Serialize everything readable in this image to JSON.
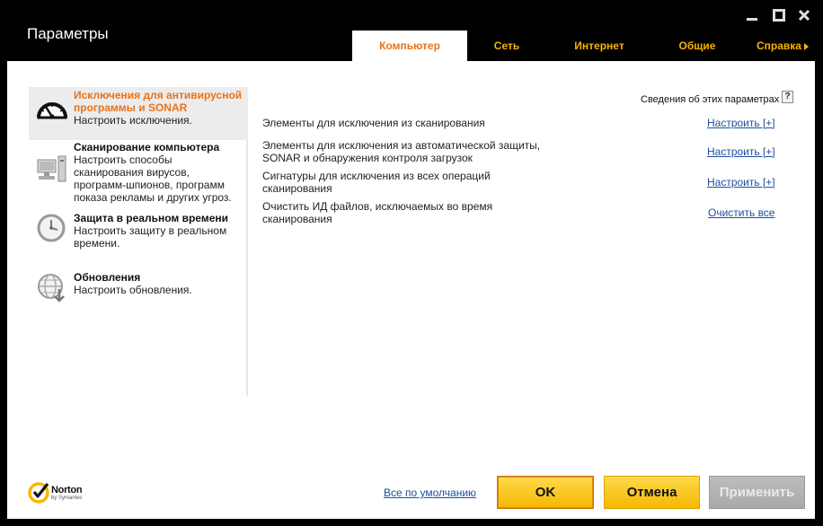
{
  "window": {
    "title": "Параметры"
  },
  "tabs": [
    {
      "label": "Компьютер",
      "active": true
    },
    {
      "label": "Сеть",
      "active": false
    },
    {
      "label": "Интернет",
      "active": false
    },
    {
      "label": "Общие",
      "active": false
    },
    {
      "label": "Справка",
      "active": false
    }
  ],
  "sidebar": {
    "items": [
      {
        "title": "Исключения для антивирусной программы и SONAR",
        "desc": "Настроить исключения.",
        "icon": "gauge-icon",
        "selected": true
      },
      {
        "title": "Сканирование компьютера",
        "desc": "Настроить способы сканирования вирусов, программ-шпионов, программ показа рекламы и других угроз.",
        "icon": "computer-icon",
        "selected": false
      },
      {
        "title": "Защита в реальном времени",
        "desc": "Настроить защиту в реальном времени.",
        "icon": "clock-icon",
        "selected": false
      },
      {
        "title": "Обновления",
        "desc": "Настроить обновления.",
        "icon": "globe-update-icon",
        "selected": false
      }
    ]
  },
  "main": {
    "info_link": "Сведения об этих параметрах",
    "help_glyph": "?",
    "rows": [
      {
        "label": "Элементы для исключения из сканирования",
        "action": "Настроить [+]"
      },
      {
        "label": "Элементы для исключения из автоматической защиты, SONAR и обнаружения контроля загрузок",
        "action": "Настроить [+]"
      },
      {
        "label": "Сигнатуры для исключения из всех операций сканирования",
        "action": "Настроить [+]"
      },
      {
        "label": "Очистить ИД файлов, исключаемых во время сканирования",
        "action": "Очистить все"
      }
    ]
  },
  "footer": {
    "brand": "Norton",
    "brand_sub": "by Symantec",
    "defaults_link": "Все по умолчанию",
    "ok": "OK",
    "cancel": "Отмена",
    "apply": "Применить"
  },
  "colors": {
    "accent_orange": "#e8731a",
    "tab_yellow": "#f5b400",
    "button_yellow": "#f5b800",
    "link_blue": "#1c4fa0"
  }
}
